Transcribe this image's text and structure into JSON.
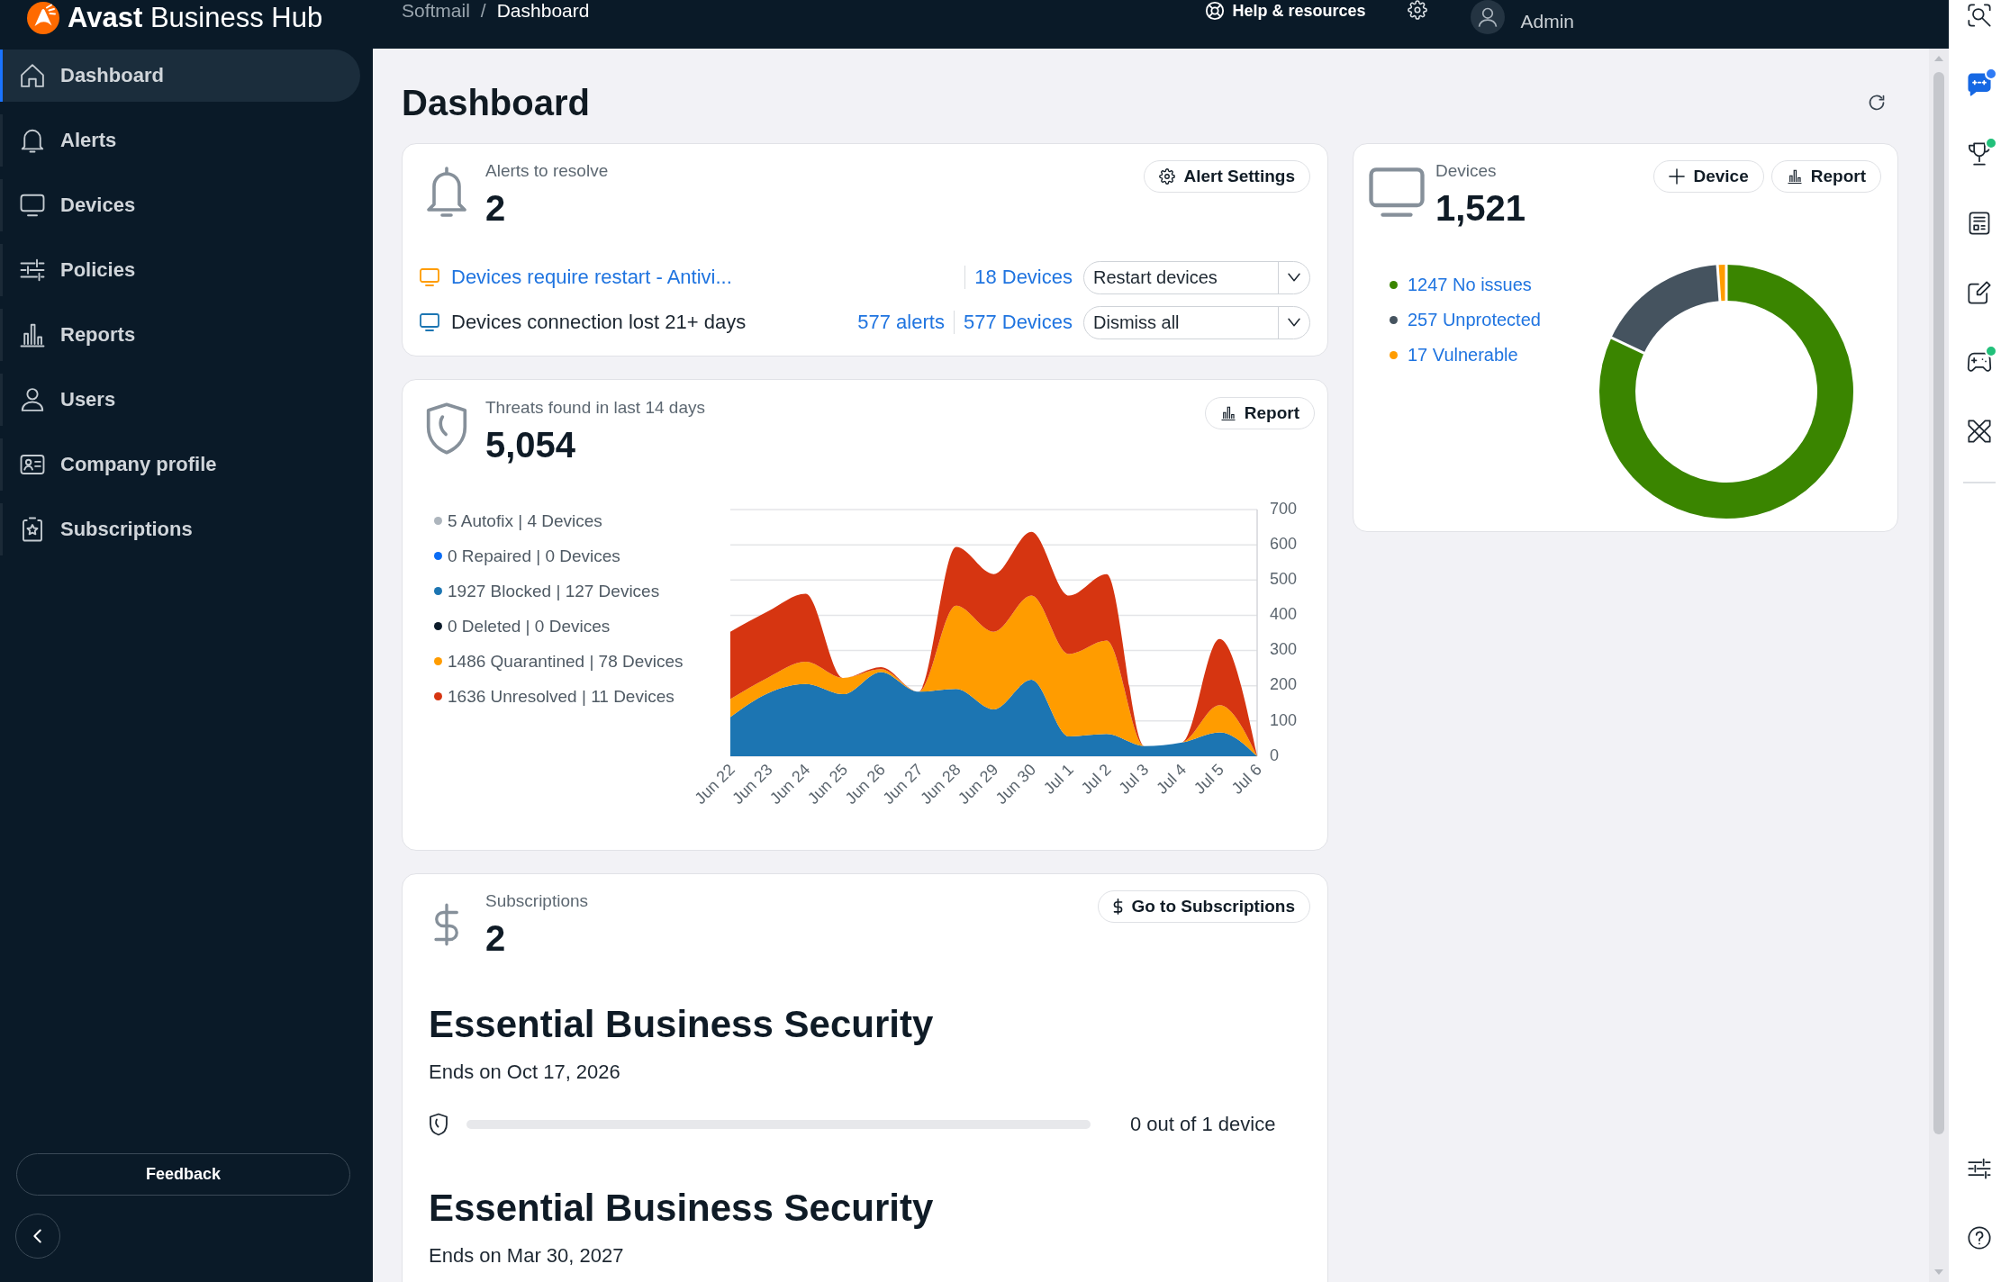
{
  "top_bar": {
    "logo_text": "**Avast** Business Hub",
    "breadcrumb": [
      {
        "label": "Softmail"
      },
      {
        "label": "Dashboard"
      }
    ],
    "breadcrumb_separator": "/",
    "help_label": "Help & resources",
    "user_name": "Admin"
  },
  "sidebar": {
    "items": [
      {
        "label": "Dashboard",
        "selected": true
      },
      {
        "label": "Alerts",
        "selected": false
      },
      {
        "label": "Devices",
        "selected": false
      },
      {
        "label": "Policies",
        "selected": false
      },
      {
        "label": "Reports",
        "selected": false
      },
      {
        "label": "Users",
        "selected": false
      },
      {
        "label": "Company profile",
        "selected": false
      },
      {
        "label": "Subscriptions",
        "selected": false
      }
    ],
    "feedback_label": "Feedback"
  },
  "page_title": "Dashboard",
  "alerts_card": {
    "label": "Alerts to resolve",
    "count": "2",
    "settings_button": "Alert Settings",
    "rows": [
      {
        "color": "#ff9c00",
        "title": "Devices require restart - Antivi...",
        "title_is_link": true,
        "devices": "18 Devices",
        "action": "Restart devices"
      },
      {
        "color": "#1c75b2",
        "title": "Devices connection lost 21+ days",
        "title_is_link": false,
        "alerts": "577 alerts",
        "devices": "577 Devices",
        "action": "Dismiss all"
      }
    ]
  },
  "devices_card": {
    "label": "Devices",
    "count": "1,521",
    "add_button": "Device",
    "report_button": "Report",
    "legend": [
      {
        "text": "1247 No issues",
        "color": "#3a8500"
      },
      {
        "text": "257 Unprotected",
        "color": "#45535f"
      },
      {
        "text": "17 Vulnerable",
        "color": "#ff9c00"
      }
    ],
    "chart_data": {
      "type": "donut",
      "values": [
        81.98,
        16.9,
        1.12
      ]
    }
  },
  "threats_card": {
    "label": "Threats found in last 14 days",
    "count": "5,054",
    "report_button": "Report",
    "legend": [
      {
        "text": "5 Autofix | 4 Devices",
        "color": "#adb5bd"
      },
      {
        "text": "0 Repaired | 0 Devices",
        "color": "#0a6cf5"
      },
      {
        "text": "1927 Blocked | 127 Devices",
        "color": "#1c75b2"
      },
      {
        "text": "0 Deleted | 0 Devices",
        "color": "#0c1b2a"
      },
      {
        "text": "1486 Quarantined | 78 Devices",
        "color": "#ff9c00"
      },
      {
        "text": "1636 Unresolved | 11 Devices",
        "color": "#d63511"
      }
    ],
    "chart_data": {
      "type": "area",
      "stacked": true,
      "grid": true,
      "categories": [
        "Jun 22",
        "Jun 23",
        "Jun 24",
        "Jun 25",
        "Jun 26",
        "Jun 27",
        "Jun 28",
        "Jun 29",
        "Jun 30",
        "Jul 1",
        "Jul 2",
        "Jul 3",
        "Jul 4",
        "Jul 5",
        "Jul 6"
      ],
      "ylim": [
        0,
        700
      ],
      "yticks": [
        0,
        100,
        200,
        300,
        400,
        500,
        600,
        700
      ],
      "series": [
        {
          "color": "#1c75b2",
          "values": [
            111,
            179,
            205,
            176,
            239,
            183,
            191,
            133,
            217,
            56,
            63,
            29,
            39,
            68,
            0
          ]
        },
        {
          "color": "#ff9c00",
          "values": [
            51,
            44,
            63,
            46,
            8,
            0,
            236,
            220,
            239,
            234,
            265,
            0,
            0,
            77,
            0
          ]
        },
        {
          "color": "#d63511",
          "values": [
            191,
            188,
            193,
            0,
            6,
            0,
            167,
            164,
            181,
            166,
            189,
            0,
            0,
            188,
            0
          ]
        }
      ]
    }
  },
  "subscriptions_card": {
    "label": "Subscriptions",
    "count": "2",
    "button": "Go to Subscriptions",
    "items": [
      {
        "name": "Essential Business Security",
        "ends": "Ends on Oct 17, 2026",
        "usage": "0 out of 1 device",
        "level": 0
      },
      {
        "name": "Essential Business Security",
        "ends": "Ends on Mar 30, 2027"
      }
    ]
  },
  "right_rail": {
    "items": [
      {
        "badge": false
      },
      {
        "badge": true,
        "color": "#2f7bf5"
      },
      {
        "badge": true,
        "color": "#22c07a"
      },
      {
        "badge": false
      },
      {
        "badge": false
      },
      {
        "badge": true,
        "color": "#22c07a"
      },
      {
        "badge": false
      }
    ],
    "bottom_items": [
      {
        "badge": false
      },
      {
        "badge": false
      }
    ]
  }
}
